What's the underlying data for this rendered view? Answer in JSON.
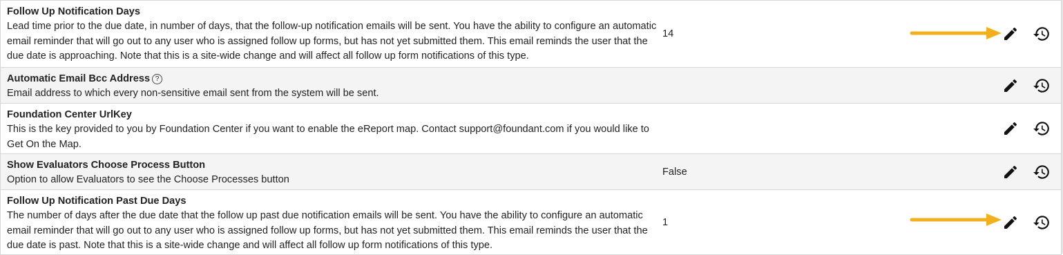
{
  "settings": [
    {
      "title": "Follow Up Notification Days",
      "description": "Lead time prior to the due date, in number of days, that the follow-up notification emails will be sent. You have the ability to configure an automatic email reminder that will go out to any user who is assigned follow up forms, but has not yet submitted them. This email reminds the user that the due date is approaching. Note that this is a site-wide change and will affect all follow up form notifications of this type.",
      "value": "14"
    },
    {
      "title": "Automatic Email Bcc Address",
      "help_glyph": "?",
      "description": "Email address to which every non-sensitive email sent from the system will be sent.",
      "value": ""
    },
    {
      "title": "Foundation Center UrlKey",
      "description": "This is the key provided to you by Foundation Center if you want to enable the eReport map. Contact support@foundant.com if you would like to Get On the Map.",
      "value": ""
    },
    {
      "title": "Show Evaluators Choose Process Button",
      "description": "Option to allow Evaluators to see the Choose Processes button",
      "value": "False"
    },
    {
      "title": "Follow Up Notification Past Due Days",
      "description": "The number of days after the due date that the follow up past due notification emails will be sent. You have the ability to configure an automatic email reminder that will go out to any user who is assigned follow up forms, but has not yet submitted them. This email reminds the user that the due date is past. Note that this is a site-wide change and will affect all follow up form notifications of this type.",
      "value": "1"
    }
  ],
  "icons": {
    "edit": "pencil-icon",
    "history": "history-icon",
    "help": "help-circle-icon"
  },
  "colors": {
    "row_alt": "#f4f4f4",
    "border": "#d6d6d6",
    "text": "#222222",
    "annotation_arrow": "#f2b01e"
  }
}
